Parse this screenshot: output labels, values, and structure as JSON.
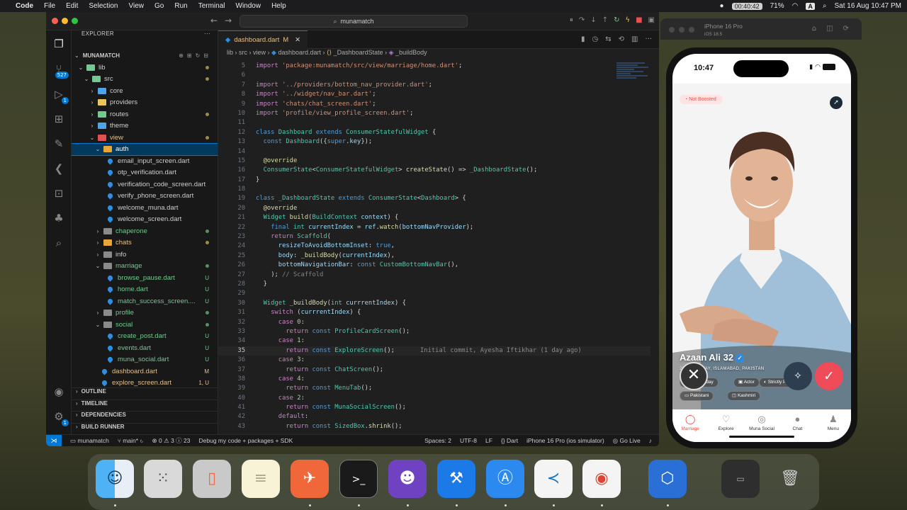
{
  "menubar": {
    "app": "Code",
    "items": [
      "File",
      "Edit",
      "Selection",
      "View",
      "Go",
      "Run",
      "Terminal",
      "Window",
      "Help"
    ],
    "recording": "00:40:42",
    "battery": "71%",
    "datetime": "Sat 16 Aug  10:47 PM"
  },
  "vscode": {
    "search": "munamatch",
    "activity_badges": {
      "scm": "527",
      "run": "1",
      "testing": "1",
      "accounts": "1"
    },
    "explorer": {
      "header": "EXPLORER",
      "project": "MUNAMATCH",
      "rows": [
        {
          "label": "lib",
          "kind": "folder",
          "depth": 1,
          "open": true,
          "color": "#73c991",
          "status": "dot-yel"
        },
        {
          "label": "src",
          "kind": "folder",
          "depth": 2,
          "open": true,
          "color": "#73c991",
          "status": "dot-yel"
        },
        {
          "label": "core",
          "kind": "folder",
          "depth": 3,
          "open": false,
          "color": "#4fa3e8",
          "status": ""
        },
        {
          "label": "providers",
          "kind": "folder",
          "depth": 3,
          "open": false,
          "color": "#e8c65a",
          "status": ""
        },
        {
          "label": "routes",
          "kind": "folder",
          "depth": 3,
          "open": false,
          "color": "#73c991",
          "status": "dot-yel"
        },
        {
          "label": "theme",
          "kind": "folder",
          "depth": 3,
          "open": false,
          "color": "#4fa3e8",
          "status": ""
        },
        {
          "label": "view",
          "kind": "folder",
          "depth": 3,
          "open": true,
          "color": "#e05252",
          "status": "dot-yel",
          "labelColor": "#e2c08d"
        },
        {
          "label": "auth",
          "kind": "folder",
          "depth": 4,
          "open": true,
          "color": "#e8a53a",
          "status": "",
          "selected": true
        },
        {
          "label": "email_input_screen.dart",
          "kind": "file",
          "depth": 5,
          "status": ""
        },
        {
          "label": "otp_verification.dart",
          "kind": "file",
          "depth": 5,
          "status": ""
        },
        {
          "label": "verification_code_screen.dart",
          "kind": "file",
          "depth": 5,
          "status": ""
        },
        {
          "label": "verify_phone_screen.dart",
          "kind": "file",
          "depth": 5,
          "status": ""
        },
        {
          "label": "welcome_muna.dart",
          "kind": "file",
          "depth": 5,
          "status": ""
        },
        {
          "label": "welcome_screen.dart",
          "kind": "file",
          "depth": 5,
          "status": ""
        },
        {
          "label": "chaperone",
          "kind": "folder",
          "depth": 4,
          "open": false,
          "color": "#8a8a8a",
          "status": "dot-grn",
          "labelColor": "#73c991"
        },
        {
          "label": "chats",
          "kind": "folder",
          "depth": 4,
          "open": false,
          "color": "#e8a53a",
          "status": "dot-yel",
          "labelColor": "#e2c08d"
        },
        {
          "label": "info",
          "kind": "folder",
          "depth": 4,
          "open": false,
          "color": "#8a8a8a",
          "status": ""
        },
        {
          "label": "marriage",
          "kind": "folder",
          "depth": 4,
          "open": true,
          "color": "#8a8a8a",
          "status": "dot-grn",
          "labelColor": "#73c991"
        },
        {
          "label": "browse_pause.dart",
          "kind": "file",
          "depth": 5,
          "status": "U",
          "labelColor": "#73c991"
        },
        {
          "label": "home.dart",
          "kind": "file",
          "depth": 5,
          "status": "U",
          "labelColor": "#73c991"
        },
        {
          "label": "match_success_screen....",
          "kind": "file",
          "depth": 5,
          "status": "U",
          "labelColor": "#73c991"
        },
        {
          "label": "profile",
          "kind": "folder",
          "depth": 4,
          "open": false,
          "color": "#8a8a8a",
          "status": "dot-grn",
          "labelColor": "#73c991"
        },
        {
          "label": "social",
          "kind": "folder",
          "depth": 4,
          "open": true,
          "color": "#8a8a8a",
          "status": "dot-grn",
          "labelColor": "#73c991"
        },
        {
          "label": "create_post.dart",
          "kind": "file",
          "depth": 5,
          "status": "U",
          "labelColor": "#73c991"
        },
        {
          "label": "events.dart",
          "kind": "file",
          "depth": 5,
          "status": "U",
          "labelColor": "#73c991"
        },
        {
          "label": "muna_social.dart",
          "kind": "file",
          "depth": 5,
          "status": "U",
          "labelColor": "#73c991"
        },
        {
          "label": "dashboard.dart",
          "kind": "file",
          "depth": 4,
          "status": "M",
          "labelColor": "#e2c08d"
        },
        {
          "label": "explore_screen.dart",
          "kind": "file",
          "depth": 4,
          "status": "1, U",
          "labelColor": "#e2c08d"
        }
      ],
      "sections": [
        "OUTLINE",
        "TIMELINE",
        "DEPENDENCIES",
        "BUILD RUNNER"
      ]
    },
    "tab": {
      "label": "dashboard.dart",
      "modified": "M"
    },
    "breadcrumb": [
      "lib",
      "src",
      "view",
      "dashboard.dart",
      "_DashboardState",
      "_buildBody"
    ],
    "blame": "Initial commit, Ayesha Iftikhar (1 day ago)",
    "status": {
      "branch": "munamatch",
      "git": "main*",
      "problems": "0",
      "warnings": "3",
      "infos": "23",
      "debug": "Debug my code + packages + SDK",
      "spaces": "Spaces: 2",
      "encoding": "UTF-8",
      "eol": "LF",
      "language": "Dart",
      "device": "iPhone 16 Pro (ios simulator)",
      "golive": "Go Live"
    }
  },
  "simulator": {
    "title": "iPhone 16 Pro",
    "subtitle": "iOS 18.5",
    "time": "10:47",
    "badge": "Not Boosted",
    "name": "Azaan Ali",
    "age": "32",
    "distance": "26.5 KM AWAY, ISLAMABAD, PAKISTAN",
    "chips": [
      "Active today",
      "Actor",
      "Strictly Practicing",
      "Pakistani",
      "Kashmiri"
    ],
    "nav": [
      "Marriage",
      "Explore",
      "Muna Social",
      "Chat",
      "Menu"
    ],
    "accent": "#ef4b59"
  }
}
